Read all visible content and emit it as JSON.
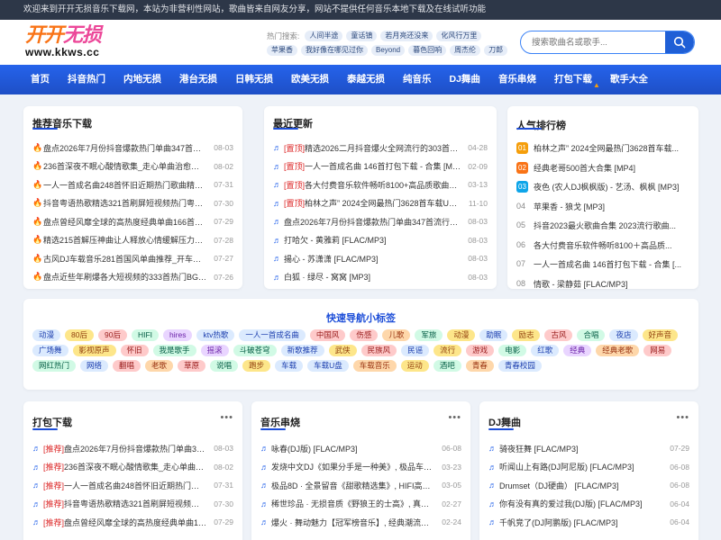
{
  "notice": "欢迎来到开开无损音乐下载网，本站为非营利性网站，歌曲皆来自网友分享，网站不提供任何音乐本地下载及在线试听功能",
  "logo": {
    "cn_a": "开开",
    "cn_b": "无损",
    "domain": "www.kkws.cc"
  },
  "hot": {
    "label": "热门搜索:",
    "tags": [
      "人间半途",
      "童话镇",
      "若月亮还没来",
      "化风行万里",
      "苹果香",
      "我好像在哪见过你",
      "Beyond",
      "暮色回响",
      "周杰伦",
      "刀郎"
    ]
  },
  "search": {
    "placeholder": "搜索歌曲名或歌手..."
  },
  "nav": [
    "首页",
    "抖音热门",
    "内地无损",
    "港台无损",
    "日韩无损",
    "欧美无损",
    "泰越无损",
    "纯音乐",
    "DJ舞曲",
    "音乐串烧",
    "打包下载",
    "歌手大全"
  ],
  "recommend": {
    "title": "推荐音乐下载",
    "items": [
      {
        "text": "盘点2026年7月份抖音爆款热门单曲347首流行歌单",
        "date": "08-03"
      },
      {
        "text": "236首深夜不眠心酸情歌集_走心单曲治愈孤单情绪",
        "date": "08-02"
      },
      {
        "text": "一人一首成名曲248首怀旧近期热门歌曲精选分享",
        "date": "07-31"
      },
      {
        "text": "抖音粤语热歌精选321首刷屏短视频热门粤语金曲集",
        "date": "07-30"
      },
      {
        "text": "盘点曾经风靡全球的高热度经典单曲166首必听歌单",
        "date": "07-29"
      },
      {
        "text": "精选215首解压神曲让人释放心情缓解压力深夜治愈",
        "date": "07-28"
      },
      {
        "text": "古风DJ车载音乐281首国风单曲推荐_开车必听的嗨",
        "date": "07-27"
      },
      {
        "text": "盘点近些年刷爆各大短视频的333首热门BGM流行",
        "date": "07-26"
      }
    ]
  },
  "recent": {
    "title": "最近更新",
    "items": [
      {
        "pre": "[置顶]",
        "text": "精选2026二月抖音爆火全网流行的303首热门",
        "date": "04-28"
      },
      {
        "pre": "[置顶]",
        "text": "一人一首成名曲 146首打包下载 - 合集 [MP3]",
        "date": "02-09"
      },
      {
        "pre": "[置顶]",
        "text": "各大付费音乐软件畅听8100+高品质歌曲排行",
        "date": "03-13"
      },
      {
        "pre": "[置顶]",
        "text": "柏林之声” 2024全网最热门3628首车载U盘高",
        "date": "11-10"
      },
      {
        "pre": "",
        "text": "盘点2026年7月份抖音爆款热门单曲347首流行歌单",
        "date": "08-03"
      },
      {
        "pre": "",
        "text": "打哈欠 - 黄雅莉 [FLAC/MP3]",
        "date": "08-03"
      },
      {
        "pre": "",
        "text": "揚心 - 苏潇潇 [FLAC/MP3]",
        "date": "08-03"
      },
      {
        "pre": "",
        "text": "白狐 · 绿尽 - 窝窝 [MP3]",
        "date": "08-03"
      }
    ]
  },
  "ranking": {
    "title": "人气排行榜",
    "items": [
      {
        "n": "01",
        "text": "柏林之声” 2024全网最热门3628首车载..."
      },
      {
        "n": "02",
        "text": "经典老哥500首大合集 [MP4]"
      },
      {
        "n": "03",
        "text": "夜色 (农人DJ枫枫版) - 艺汤、枫枫 [MP3]"
      },
      {
        "n": "04",
        "text": "苹果香 - 狼戈 [MP3]"
      },
      {
        "n": "05",
        "text": "抖音2023最火歌曲合集 2023流行歌曲..."
      },
      {
        "n": "06",
        "text": "各大付费音乐软件畅听8100＋高品质..."
      },
      {
        "n": "07",
        "text": "一人一首成名曲 146首打包下载 - 合集 [..."
      },
      {
        "n": "08",
        "text": "情歌 - 梁静茹 [FLAC/MP3]"
      }
    ]
  },
  "quick_tags": {
    "title": "快速导航小标签",
    "tags": [
      "动漫",
      "80后",
      "90后",
      "HIFI",
      "hires",
      "ktv热歌",
      "一人一首成名曲",
      "中国风",
      "伤感",
      "儿歌",
      "军旅",
      "动漫",
      "助眠",
      "励志",
      "古风",
      "合唱",
      "夜店",
      "好声音",
      "广场舞",
      "影视原声",
      "怀旧",
      "我是歌手",
      "摇滚",
      "斗破苍穹",
      "新歌推荐",
      "武侠",
      "民族风",
      "民谣",
      "流行",
      "游戏",
      "电影",
      "红歌",
      "经典",
      "经典老歌",
      "网易",
      "网红热门",
      "网络",
      "翻唱",
      "老歌",
      "草原",
      "说唱",
      "跑步",
      "车载",
      "车载U盘",
      "车载音乐",
      "运动",
      "酒吧",
      "青春",
      "青春校园"
    ]
  },
  "pack": {
    "title": "打包下载",
    "items": [
      {
        "pre": "[推荐]",
        "text": "盘点2026年7月份抖音爆款热门单曲347...",
        "date": "08-03"
      },
      {
        "pre": "[推荐]",
        "text": "236首深夜不眠心酸情歌集_走心单曲治...",
        "date": "08-02"
      },
      {
        "pre": "[推荐]",
        "text": "一人一首成名曲248首怀旧近期热门歌曲...",
        "date": "07-31"
      },
      {
        "pre": "[推荐]",
        "text": "抖音粤语热歌精选321首刷屏短视频热门...",
        "date": "07-30"
      },
      {
        "pre": "[推荐]",
        "text": "盘点曾经风靡全球的高热度经典单曲166...",
        "date": "07-29"
      }
    ]
  },
  "medley": {
    "title": "音乐串烧",
    "items": [
      {
        "text": "咏春(DJ版) [FLAC/MP3]",
        "date": "06-08"
      },
      {
        "text": "发烧中文DJ《如果分手是一种美》, 极品车载CL...",
        "date": "03-23"
      },
      {
        "text": "极品8D · 全景留音《甜歌精选集》, HIFI高清车...",
        "date": "03-05"
      },
      {
        "text": "稀世珍品 · 无损音质《野狼王的士高》, 真空管...",
        "date": "02-27"
      },
      {
        "text": "爆火 · 舞动魅力【冠军榜音乐】, 经典潮流车载...",
        "date": "02-24"
      }
    ]
  },
  "dj": {
    "title": "DJ舞曲",
    "items": [
      {
        "text": "骑夜狂舞 [FLAC/MP3]",
        "date": "07-29"
      },
      {
        "text": "听闻山上有路(DJ阿尼版) [FLAC/MP3]",
        "date": "06-08"
      },
      {
        "text": "Drumset（DJ硬曲） [FLAC/MP3]",
        "date": "06-08"
      },
      {
        "text": "你有没有真的爱过我(DJ版) [FLAC/MP3]",
        "date": "06-04"
      },
      {
        "text": "千帆竞了(DJ阿鹏版) [FLAC/MP3]",
        "date": "06-04"
      }
    ]
  },
  "colors": {
    "nav": "#1e4fc6",
    "accent": "#1d4ed8",
    "top_pre": "#dc2626",
    "bg": "#eef2f8"
  },
  "icons": {
    "search": "magnifier-icon",
    "fire": "fire-icon",
    "note": "music-note-icon",
    "more": "more-dots-icon"
  }
}
